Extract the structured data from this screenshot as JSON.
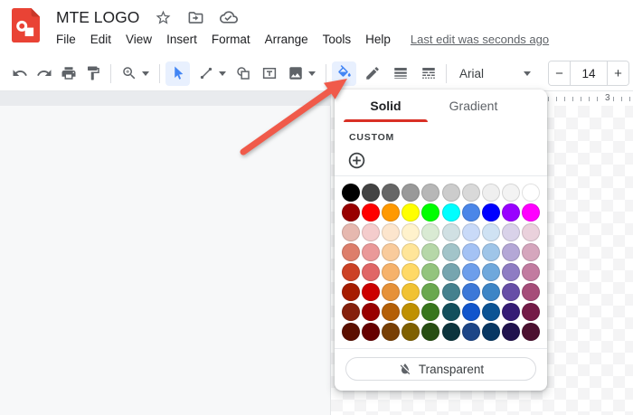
{
  "app": {
    "title": "MTE LOGO",
    "menu_items": [
      "File",
      "Edit",
      "View",
      "Insert",
      "Format",
      "Arrange",
      "Tools",
      "Help"
    ],
    "last_edit": "Last edit was seconds ago"
  },
  "toolbar": {
    "tools": [
      "undo",
      "redo",
      "print",
      "paint-format",
      "zoom",
      "select",
      "line",
      "shape",
      "text-box",
      "image",
      "fill-color",
      "border-color",
      "border-weight",
      "border-dash"
    ],
    "active_tools": [
      "select",
      "fill-color"
    ],
    "font_family": "Arial",
    "font_size": "14",
    "decrease_label": "−",
    "increase_label": "+"
  },
  "ruler": {
    "label": "3"
  },
  "panel": {
    "tabs": [
      {
        "label": "Solid",
        "active": true
      },
      {
        "label": "Gradient",
        "active": false
      }
    ],
    "custom_label": "CUSTOM",
    "transparent_label": "Transparent",
    "palette": [
      [
        "#000000",
        "#434343",
        "#666666",
        "#999999",
        "#b7b7b7",
        "#cccccc",
        "#d9d9d9",
        "#efefef",
        "#f3f3f3",
        "#ffffff"
      ],
      [
        "#980000",
        "#ff0000",
        "#ff9900",
        "#ffff00",
        "#00ff00",
        "#00ffff",
        "#4a86e8",
        "#0000ff",
        "#9900ff",
        "#ff00ff"
      ],
      [
        "#e6b8af",
        "#f4cccc",
        "#fce5cd",
        "#fff2cc",
        "#d9ead3",
        "#d0e0e3",
        "#c9daf8",
        "#cfe2f3",
        "#d9d2e9",
        "#ead1dc"
      ],
      [
        "#dd7e6b",
        "#ea9999",
        "#f9cb9c",
        "#ffe599",
        "#b6d7a8",
        "#a2c4c9",
        "#a4c2f4",
        "#9fc5e8",
        "#b4a7d6",
        "#d5a6bd"
      ],
      [
        "#cc4125",
        "#e06666",
        "#f6b26b",
        "#ffd966",
        "#93c47d",
        "#76a5af",
        "#6d9eeb",
        "#6fa8dc",
        "#8e7cc3",
        "#c27ba0"
      ],
      [
        "#a61c00",
        "#cc0000",
        "#e69138",
        "#f1c232",
        "#6aa84f",
        "#45818e",
        "#3c78d8",
        "#3d85c6",
        "#674ea7",
        "#a64d79"
      ],
      [
        "#85200c",
        "#990000",
        "#b45f06",
        "#bf9000",
        "#38761d",
        "#134f5c",
        "#1155cc",
        "#0b5394",
        "#351c75",
        "#741b47"
      ],
      [
        "#5b0f00",
        "#660000",
        "#783f04",
        "#7f6000",
        "#274e13",
        "#0c343d",
        "#1c4587",
        "#073763",
        "#20124d",
        "#4c1130"
      ]
    ]
  },
  "colors": {
    "accent_blue": "#4285f4",
    "highlight_bg": "#e8f0fe",
    "tab_underline": "#d93025",
    "annotation_arrow": "#f05a4a",
    "logo_red": "#e94335"
  }
}
